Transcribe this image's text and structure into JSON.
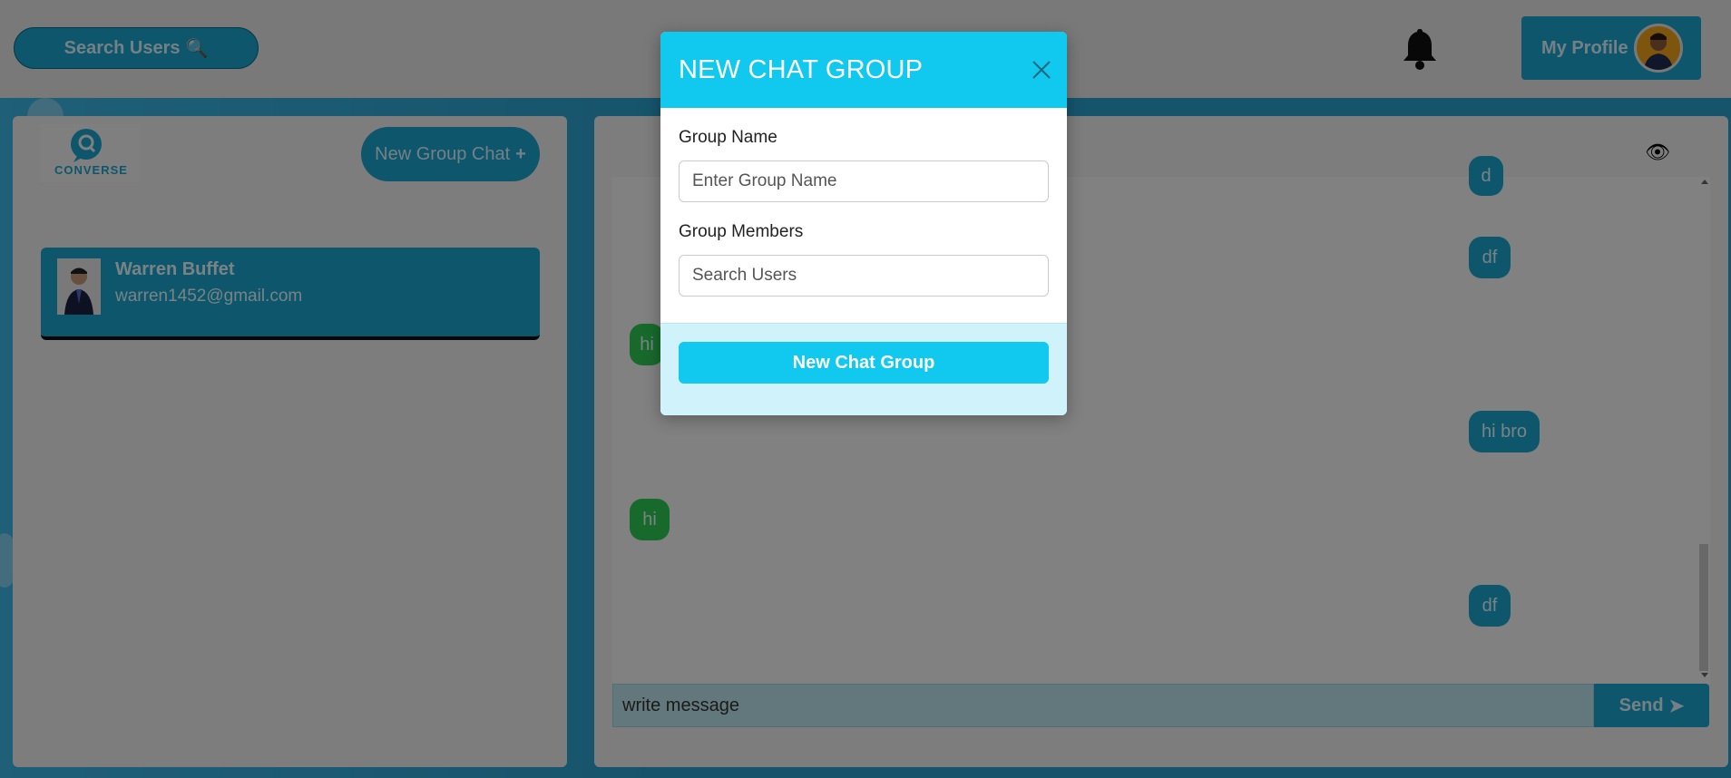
{
  "header": {
    "search_users_label": "Search Users",
    "search_icon_glyph": "🔍",
    "my_profile_label": "My Profile"
  },
  "sidebar": {
    "logo_text": "CONVERSE",
    "new_group_label": "New Group Chat",
    "new_group_plus": "+",
    "chats": [
      {
        "name": "Warren Buffet",
        "email": "warren1452@gmail.com"
      }
    ]
  },
  "chat": {
    "eye_icon_glyph": "👁",
    "messages": [
      {
        "text": "d",
        "side": "out"
      },
      {
        "text": "df",
        "side": "out"
      },
      {
        "text": "hi",
        "side": "in"
      },
      {
        "text": "hi bro",
        "side": "out"
      },
      {
        "text": "hi",
        "side": "in"
      },
      {
        "text": "df",
        "side": "out"
      }
    ],
    "input_placeholder": "write message",
    "send_label": "Send",
    "send_icon_glyph": "➤"
  },
  "modal": {
    "title": "NEW CHAT GROUP",
    "group_name_label": "Group Name",
    "group_name_placeholder": "Enter Group Name",
    "group_members_label": "Group Members",
    "group_members_placeholder": "Search Users",
    "submit_label": "New Chat Group"
  },
  "colors": {
    "accent": "#1aa6cf",
    "modal_header": "#11c8ee",
    "incoming_message": "#2ecc55"
  }
}
